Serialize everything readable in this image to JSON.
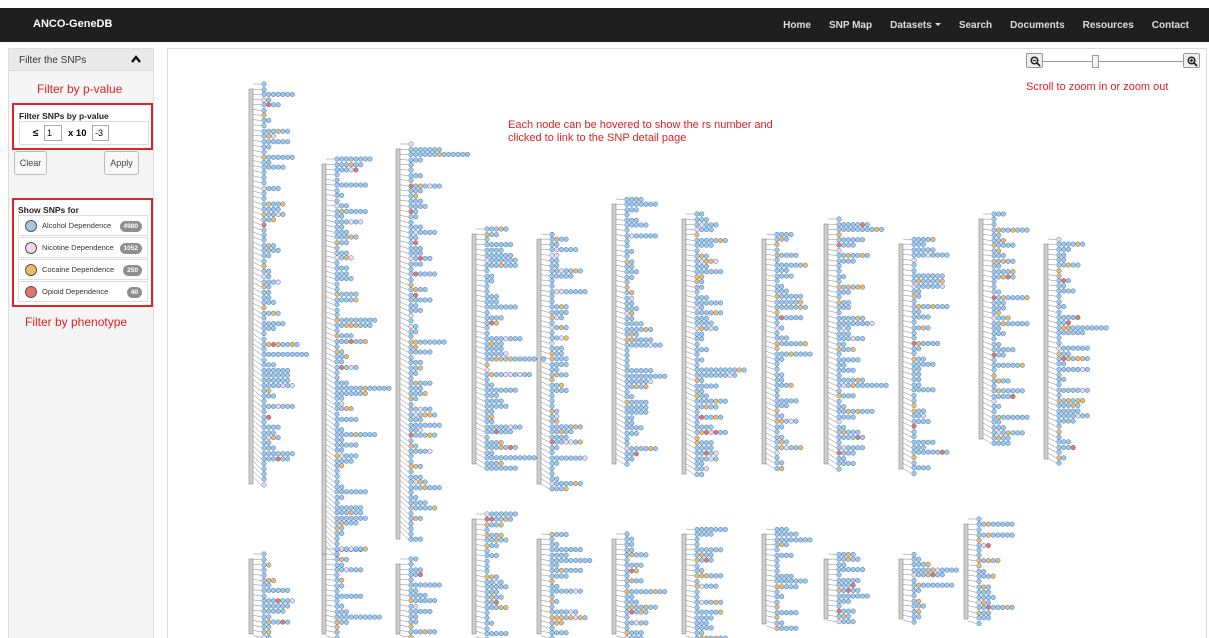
{
  "navbar": {
    "brand": "ANCO-GeneDB",
    "items": [
      "Home",
      "SNP Map",
      "Datasets",
      "Search",
      "Documents",
      "Resources",
      "Contact"
    ]
  },
  "sidebar": {
    "title": "Filter the SNPs",
    "annotation_pvalue": "Filter by p-value",
    "pvalue_box": {
      "title": "Filter SNPs by p-value",
      "le": "≤",
      "mantissa": "1",
      "times": "x 10",
      "exponent": "-3"
    },
    "clear_label": "Clear",
    "apply_label": "Apply",
    "phenotype_box": {
      "title": "Show SNPs for",
      "items": [
        {
          "label": "Alcohol Dependence",
          "count": "4980",
          "color": "#9ec7ea"
        },
        {
          "label": "Nicotine Dependence",
          "count": "1052",
          "color": "#ecd8e8"
        },
        {
          "label": "Cocaine Dependence",
          "count": "250",
          "color": "#f2b95f"
        },
        {
          "label": "Opioid Dependence",
          "count": "40",
          "color": "#e9756a"
        }
      ]
    },
    "annotation_phenotype": "Filter by phenotype"
  },
  "main": {
    "hint_line1": "Each node can be hovered to show the rs number and",
    "hint_line2": "clicked to link to the SNP detail page",
    "zoom_hint": "Scroll to zoom in  or  zoom out",
    "zoom_level": 0.38
  },
  "colors": {
    "alcohol": "#9ec7ea",
    "nicotine": "#ecd8e8",
    "cocaine": "#f2b95f",
    "opioid": "#e9756a",
    "node_stroke": "#4d76a8"
  }
}
